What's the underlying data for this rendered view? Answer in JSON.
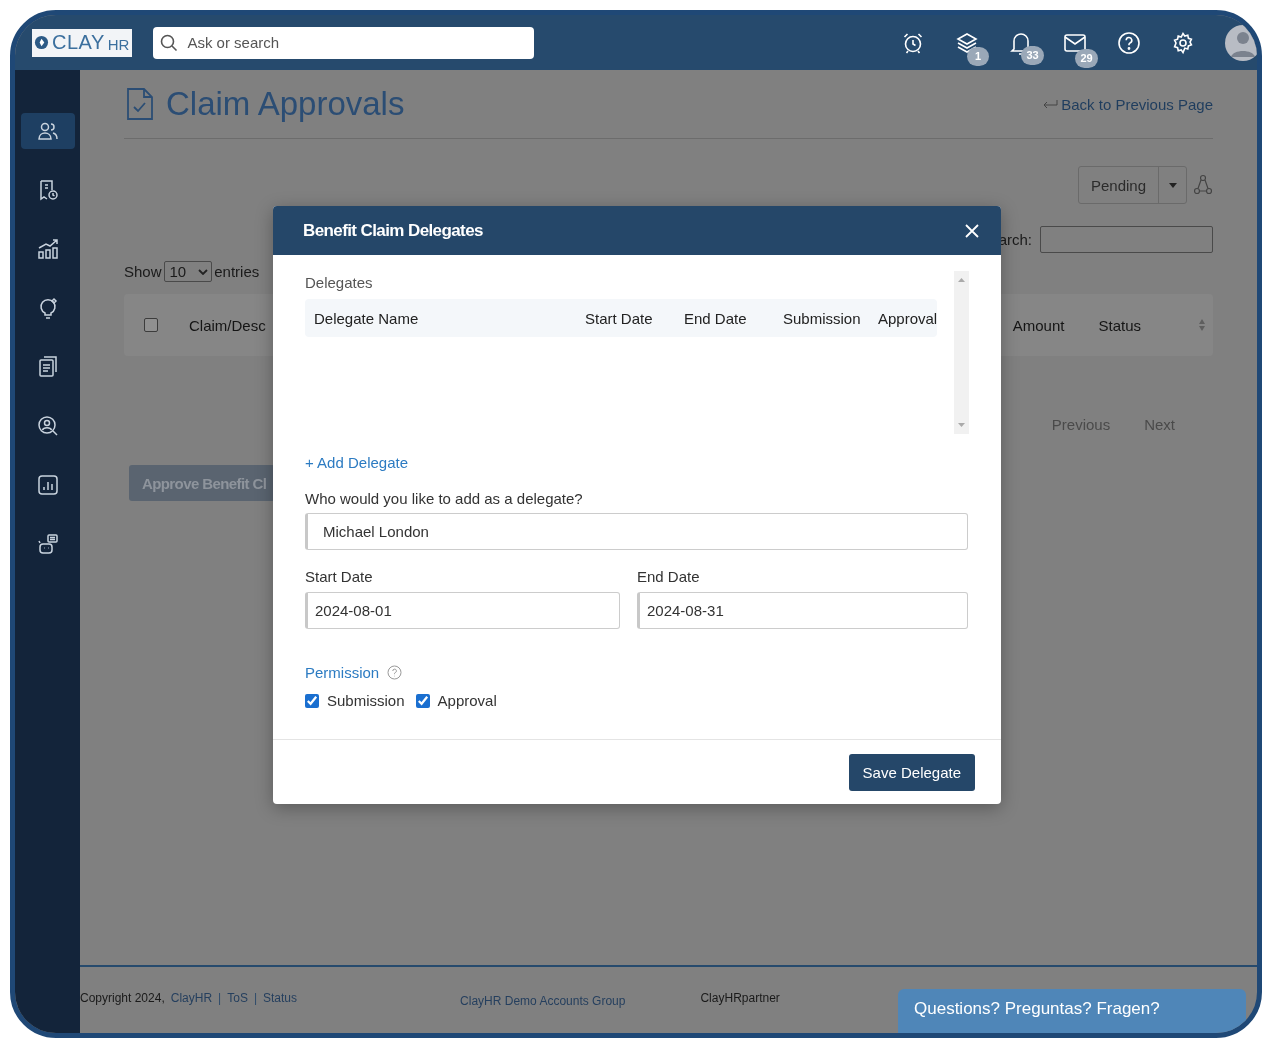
{
  "header": {
    "logo": {
      "main": "CLAY",
      "suffix": "HR"
    },
    "search": {
      "placeholder": "Ask or search"
    },
    "actions": [
      {
        "kind": "alarm"
      },
      {
        "kind": "layers",
        "badge": "1"
      },
      {
        "kind": "bell",
        "badge": "33"
      },
      {
        "kind": "mail",
        "badge": "29"
      },
      {
        "kind": "help"
      },
      {
        "kind": "settings"
      },
      {
        "kind": "avatar"
      }
    ]
  },
  "sidebar": {
    "items": [
      {
        "kind": "people",
        "selected": true
      },
      {
        "kind": "receipt",
        "selected": false
      },
      {
        "kind": "growth",
        "selected": false
      },
      {
        "kind": "bulb",
        "selected": false
      },
      {
        "kind": "documents",
        "selected": false
      },
      {
        "kind": "person-search",
        "selected": false
      },
      {
        "kind": "report",
        "selected": false
      },
      {
        "kind": "bot",
        "selected": false
      }
    ]
  },
  "page": {
    "title": "Claim Approvals",
    "back_link": "Back to Previous Page",
    "status_filter": "Pending",
    "search_label": "arch:",
    "show": {
      "before": "Show",
      "value": "10",
      "after": "entries"
    },
    "table": {
      "select_all": {
        "checked": false
      },
      "columns": [
        "Claim/Desc",
        "Amount",
        "Status"
      ]
    },
    "pagination": [
      "Previous",
      "Next"
    ],
    "approve_button": "Approve Benefit Cl"
  },
  "modal": {
    "title": "Benefit Claim Delegates",
    "section": "Delegates",
    "columns": [
      "Delegate Name",
      "Start Date",
      "End Date",
      "Submission",
      "Approval"
    ],
    "add_link": "+ Add Delegate",
    "question": "Who would you like to add as a delegate?",
    "delegate": "Michael London",
    "start_label": "Start Date",
    "start_value": "2024-08-01",
    "end_label": "End Date",
    "end_value": "2024-08-31",
    "permission_label": "Permission",
    "permissions": [
      {
        "label": "Submission",
        "checked": true
      },
      {
        "label": "Approval",
        "checked": true
      }
    ],
    "save_button": "Save Delegate"
  },
  "footer": {
    "copyright": "Copyright 2024,",
    "links": [
      "ClayHR",
      "ToS",
      "Status"
    ],
    "separators": [
      "|",
      "|"
    ],
    "group": "ClayHR Demo Accounts Group",
    "partner": "ClayHRpartner",
    "chat": "Questions? Preguntas? Fragen?"
  }
}
